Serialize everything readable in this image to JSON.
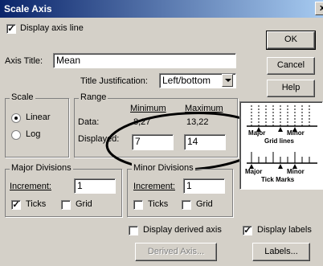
{
  "window": {
    "title": "Scale Axis",
    "close_glyph": "x"
  },
  "display_axis_line": {
    "label": "Display axis line",
    "checked": true
  },
  "axis_title": {
    "label": "Axis Title:",
    "value": "Mean"
  },
  "title_justification": {
    "label": "Title Justification:",
    "value": "Left/bottom"
  },
  "buttons": {
    "ok": "OK",
    "cancel": "Cancel",
    "help": "Help",
    "derived_axis": "Derived Axis...",
    "labels": "Labels..."
  },
  "scale": {
    "group_label": "Scale",
    "linear": "Linear",
    "log": "Log",
    "selected": "Linear"
  },
  "range": {
    "group_label": "Range",
    "minimum_header": "Minimum",
    "maximum_header": "Maximum",
    "data_label": "Data:",
    "data_min": "8,27",
    "data_max": "13,22",
    "displayed_label": "Displayed:",
    "displayed_min": "7",
    "displayed_max": "14"
  },
  "preview": {
    "top_labels": {
      "major": "Major",
      "minor": "Minor",
      "caption": "Grid lines"
    },
    "bottom_labels": {
      "major": "Major",
      "minor": "Minor",
      "caption": "Tick Marks"
    }
  },
  "major_divisions": {
    "group_label": "Major Divisions",
    "increment_label": "Increment:",
    "increment": "1",
    "ticks_label": "Ticks",
    "ticks": true,
    "grid_label": "Grid",
    "grid": false
  },
  "minor_divisions": {
    "group_label": "Minor Divisions",
    "increment_label": "Increment:",
    "increment": "1",
    "ticks_label": "Ticks",
    "ticks": false,
    "grid_label": "Grid",
    "grid": false
  },
  "display_derived_axis": {
    "label": "Display derived axis",
    "checked": false
  },
  "display_labels": {
    "label": "Display labels",
    "checked": true
  },
  "colors": {
    "titlebar_start": "#0a246a",
    "titlebar_end": "#a6caf0",
    "face": "#d4d0c8"
  }
}
